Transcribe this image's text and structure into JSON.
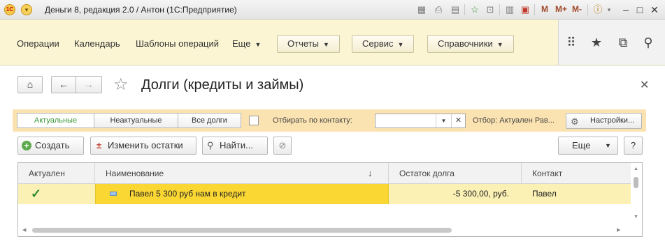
{
  "window": {
    "title": "Деньги 8, редакция 2.0 / Антон  (1С:Предприятие)",
    "logo_text": "1С",
    "memory_buttons": [
      "M",
      "M+",
      "M-"
    ]
  },
  "sections": {
    "links": [
      "Операции",
      "Календарь",
      "Шаблоны операций",
      "Еще"
    ],
    "buttons": [
      "Отчеты",
      "Сервис",
      "Справочники"
    ]
  },
  "form": {
    "title": "Долги (кредиты и займы)"
  },
  "filter": {
    "segments": [
      "Актуальные",
      "Неактуальные",
      "Все долги"
    ],
    "contact_label": "Отбирать по контакту:",
    "contact_value": "",
    "selection_text": "Отбор:  Актуален Рав...",
    "settings_label": "Настройки..."
  },
  "commands": {
    "create": "Создать",
    "change_balances": "Изменить остатки",
    "find": "Найти...",
    "more": "Еще",
    "help": "?"
  },
  "table": {
    "columns": [
      "Актуален",
      "Наименование",
      "Остаток долга",
      "Контакт"
    ],
    "sort_indicator": "↓",
    "rows": [
      {
        "actual": "✓",
        "name": "Павел 5 300 руб нам в кредит",
        "balance": "-5 300,00, руб.",
        "contact": "Павел"
      }
    ]
  },
  "colors": {
    "sections_bg": "#fbf5d3",
    "filter_bg": "#fbe3b1",
    "row_selected": "#fbd733",
    "row_bg": "#fbf1b4",
    "check_green": "#2e8b2e"
  },
  "icons": [
    "home-icon",
    "arrow-left-icon",
    "arrow-right-icon",
    "star-icon",
    "close-icon",
    "grid-icon",
    "favorites-icon",
    "history-icon",
    "search-icon"
  ]
}
